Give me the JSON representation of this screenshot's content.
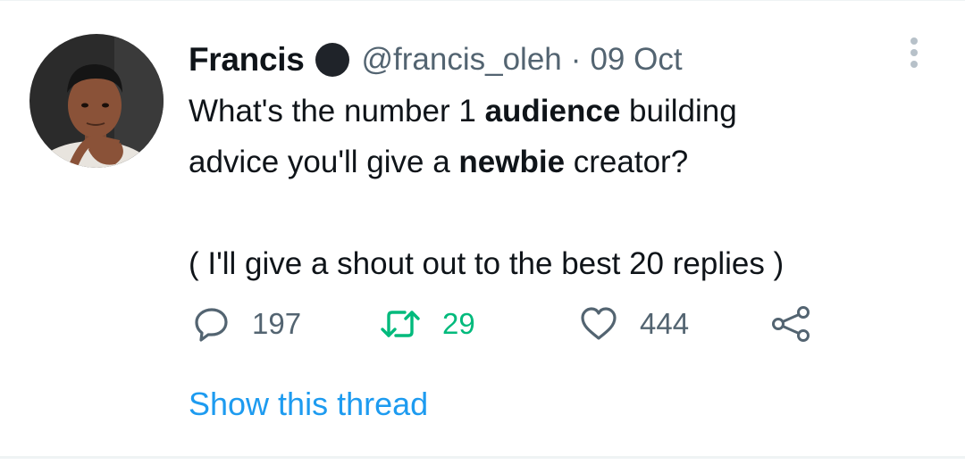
{
  "tweet": {
    "author_name": "Francis",
    "handle": "@francis_oleh",
    "separator": "·",
    "date": "09 Oct",
    "text": {
      "line1_before": "What's the number 1 ",
      "line1_bold": "audience",
      "line1_after": " building",
      "line2_before": "advice you'll give a ",
      "line2_bold": "newbie",
      "line2_after": " creator?",
      "line3": "( I'll give a shout out to the best 20 replies )"
    },
    "actions": {
      "reply_count": "197",
      "retweet_count": "29",
      "like_count": "444"
    },
    "show_thread": "Show this thread"
  },
  "icons": [
    "avatar-photo",
    "verified-badge",
    "more-options-icon",
    "reply-icon",
    "retweet-icon",
    "like-icon",
    "share-icon"
  ],
  "colors": {
    "text": "#0f1419",
    "secondary": "#536471",
    "link": "#1d9bf0",
    "retweet_active": "#00ba7c"
  }
}
